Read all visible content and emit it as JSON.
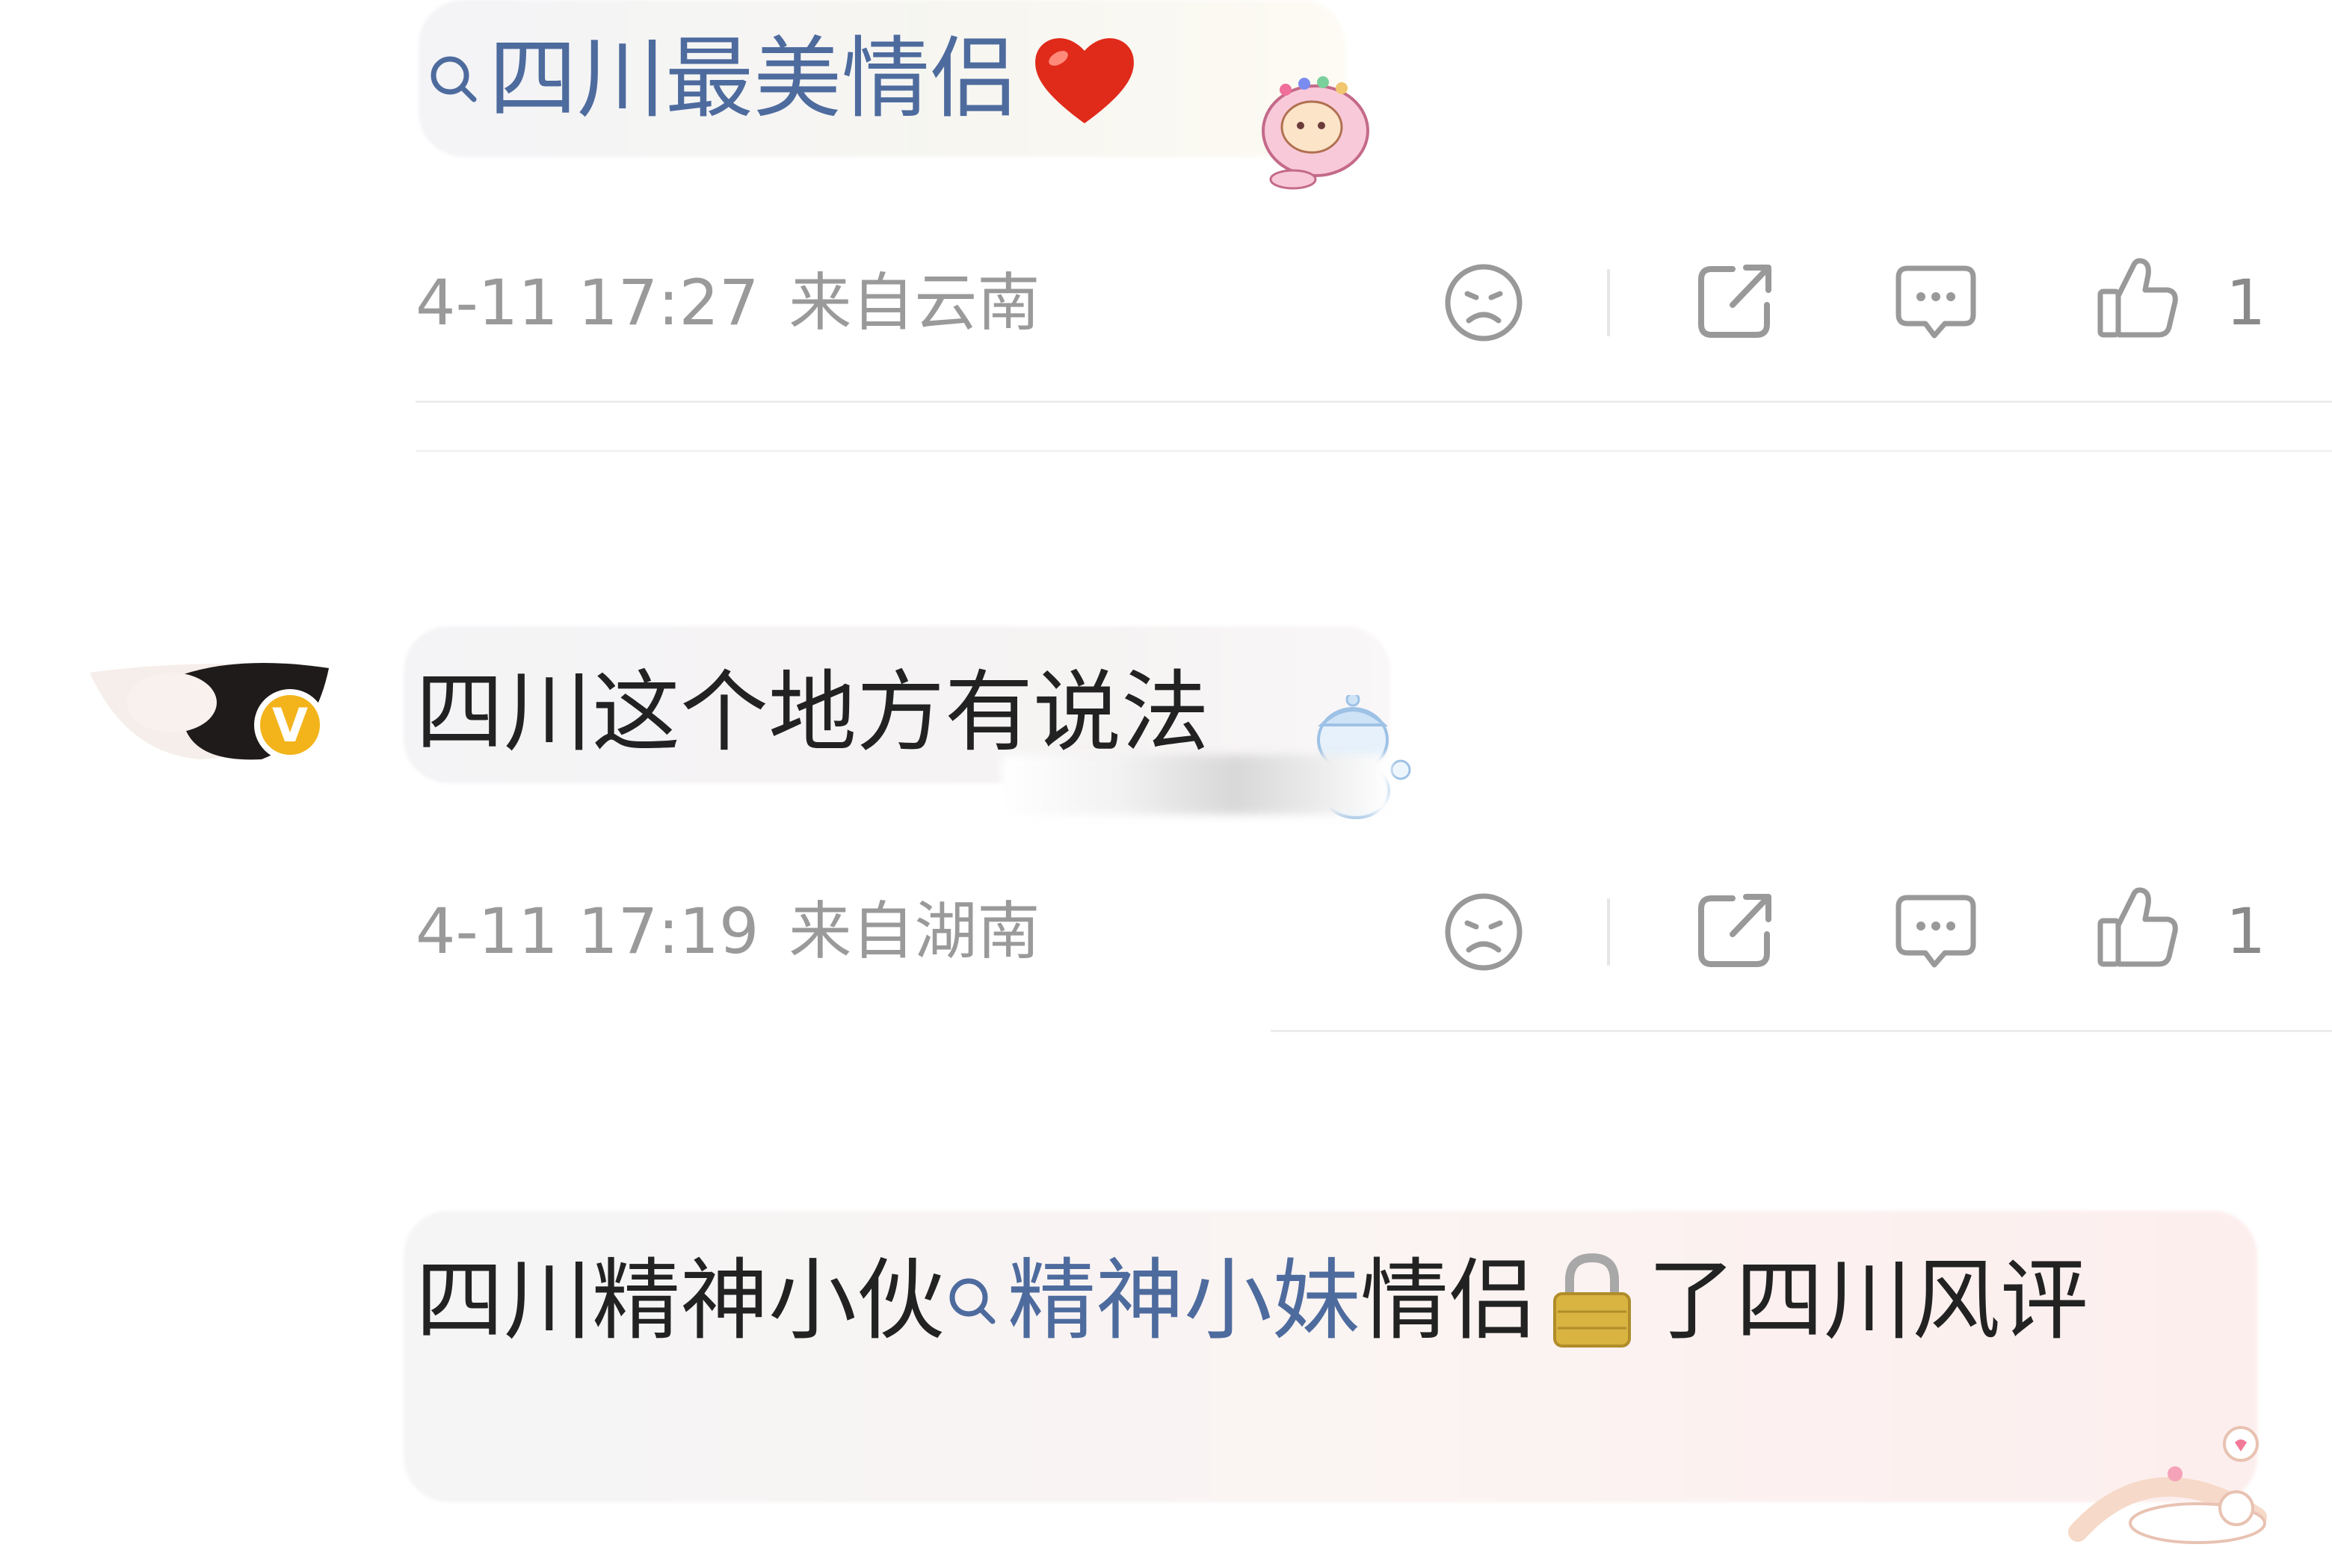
{
  "comments": [
    {
      "topic_text": "四川最美情侣",
      "emoji_heart": "❤️",
      "timestamp": "4-11 17:27",
      "location": "来自云南",
      "like_count": "1"
    },
    {
      "text": "四川这个地方有说法",
      "timestamp": "4-11 17:19",
      "location": "来自湖南",
      "like_count": "1"
    },
    {
      "text_before": "四川精神小伙",
      "topic_text": "精神小妹",
      "text_mid": "情侣",
      "emoji_lock": "🔒",
      "text_after": "了四川风评"
    }
  ],
  "colors": {
    "topic_link": "#4e6b9e",
    "meta_text": "#9a9a9a",
    "verified_badge": "#f3b41b"
  },
  "icons": {
    "dislike": "sad-face-icon",
    "share": "share-icon",
    "comment": "comment-icon",
    "like": "thumbs-up-icon",
    "topic": "search-icon",
    "verified": "verified-v-badge-icon"
  }
}
